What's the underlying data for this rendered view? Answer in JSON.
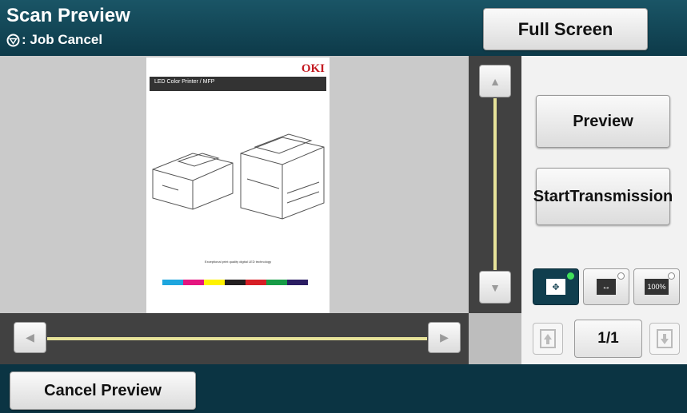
{
  "header": {
    "title": "Scan Preview",
    "subtitle": ": Job Cancel",
    "fullscreen_label": "Full Screen"
  },
  "document": {
    "header_text": "LED Color Printer / MFP",
    "brand": "OKI",
    "tagline": "Exceptional print quality digital LED technology",
    "swatch_colors": [
      "#1ea6de",
      "#e4157f",
      "#fff200",
      "#231f20",
      "#d71f26",
      "#179b46",
      "#2b1e63"
    ]
  },
  "actions": {
    "preview_label": "Preview",
    "start_label_line1": "Start",
    "start_label_line2": "Transmission",
    "cancel_preview_label": "Cancel Preview"
  },
  "view_modes": {
    "fit_page_icon": "fit-page-icon",
    "fit_width_icon": "fit-width-icon",
    "actual_size_label": "100%",
    "active_mode": "fit-page"
  },
  "pager": {
    "page_indicator": "1/1"
  },
  "colors": {
    "header_bg": "#0e3a48",
    "scroll_track": "#e7e39a",
    "active_indicator": "#3fe05a"
  }
}
